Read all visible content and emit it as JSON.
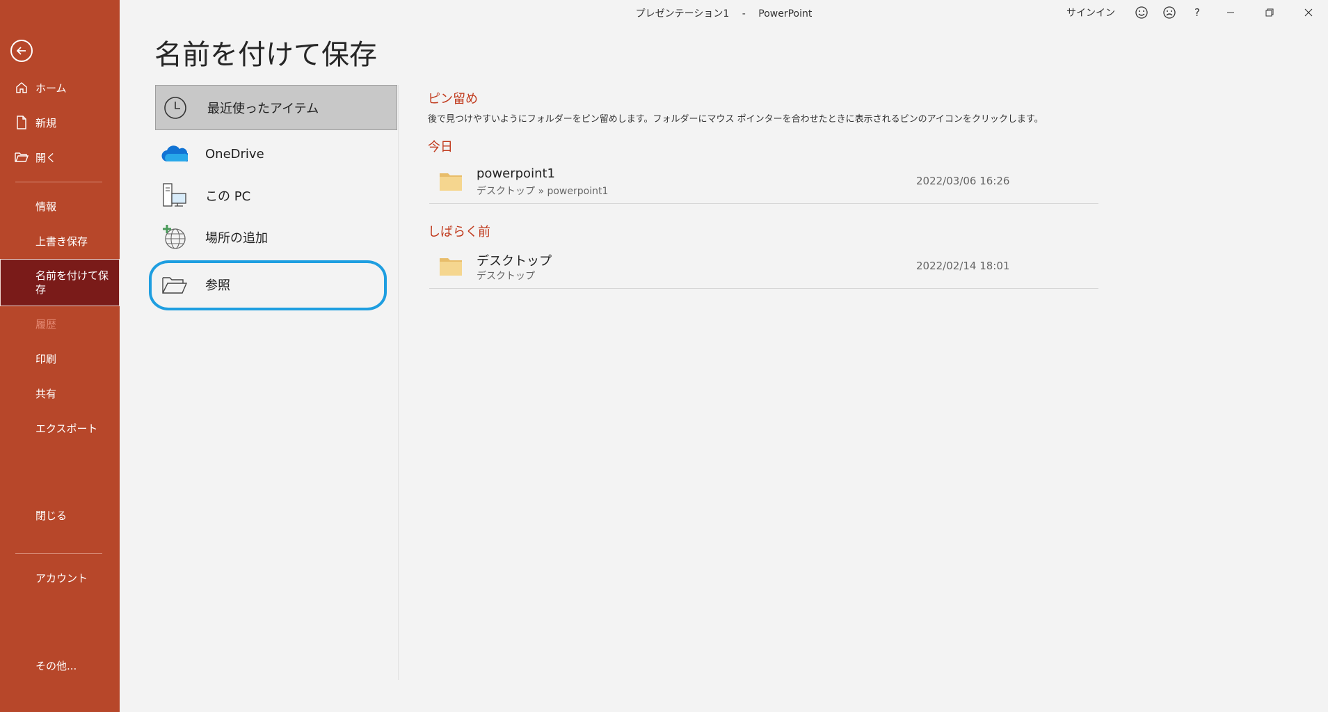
{
  "app": {
    "document_name": "プレゼンテーション1",
    "separator": "-",
    "app_name": "PowerPoint"
  },
  "titlebar": {
    "signin": "サインイン",
    "help": "?"
  },
  "sidebar": {
    "items": [
      {
        "label": "ホーム"
      },
      {
        "label": "新規"
      },
      {
        "label": "開く"
      },
      {
        "label": "情報"
      },
      {
        "label": "上書き保存"
      },
      {
        "label": "名前を付けて保存"
      },
      {
        "label": "履歴"
      },
      {
        "label": "印刷"
      },
      {
        "label": "共有"
      },
      {
        "label": "エクスポート"
      },
      {
        "label": "閉じる"
      },
      {
        "label": "アカウント"
      },
      {
        "label": "その他..."
      }
    ]
  },
  "page": {
    "title": "名前を付けて保存"
  },
  "locations": [
    {
      "label": "最近使ったアイテム",
      "icon": "clock-icon"
    },
    {
      "label": "OneDrive",
      "icon": "onedrive-cloud-icon"
    },
    {
      "label": "この PC",
      "icon": "computer-icon"
    },
    {
      "label": "場所の追加",
      "icon": "add-place-globe-icon"
    },
    {
      "label": "参照",
      "icon": "open-folder-icon"
    }
  ],
  "pinned": {
    "title": "ピン留め",
    "description": "後で見つけやすいようにフォルダーをピン留めします。フォルダーにマウス ポインターを合わせたときに表示されるピンのアイコンをクリックします。"
  },
  "groups": [
    {
      "title": "今日",
      "items": [
        {
          "name": "powerpoint1",
          "path": "デスクトップ » powerpoint1",
          "date": "2022/03/06 16:26"
        }
      ]
    },
    {
      "title": "しばらく前",
      "items": [
        {
          "name": "デスクトップ",
          "path": "デスクトップ",
          "date": "2022/02/14 18:01"
        }
      ]
    }
  ],
  "colors": {
    "sidebar": "#b7472a",
    "sidebar_active": "#7a1b19",
    "accent_text": "#c0391c",
    "annotation_ring": "#1e9ee0"
  }
}
